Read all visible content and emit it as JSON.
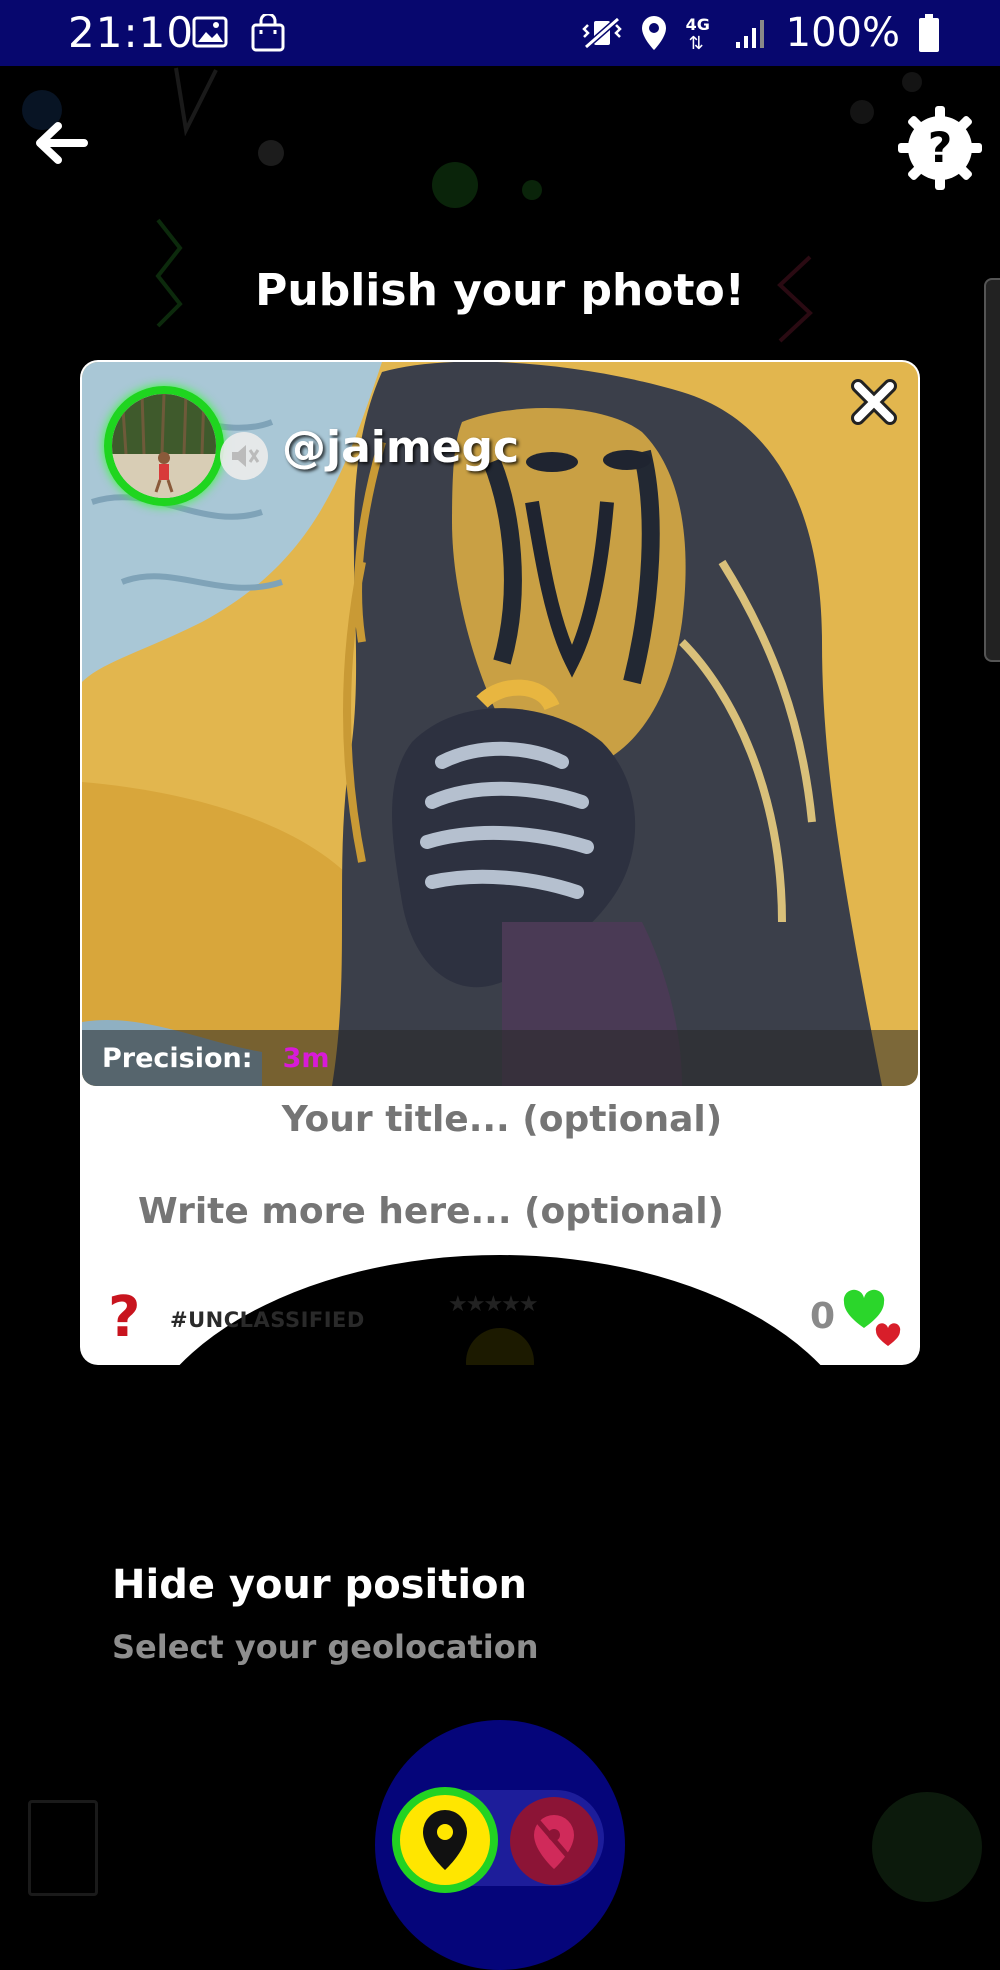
{
  "status_bar": {
    "time": "21:10",
    "icons_left": [
      "gallery-icon",
      "shopping-bag-icon"
    ],
    "icons_right": [
      "vibrate-mute-icon",
      "location-icon",
      "4g-data-icon",
      "signal-icon",
      "battery-icon"
    ],
    "network": "4G",
    "battery": "100%"
  },
  "header": {
    "back_icon": "arrow-left-icon",
    "help_icon": "help-gear-icon",
    "title": "Publish your photo!"
  },
  "card": {
    "username": "@jaimegc",
    "close_icon": "close-icon",
    "mute_icon": "mute-speaker-icon",
    "precision_label": "Precision:",
    "precision_value": "3m",
    "title_placeholder": "Your title... (optional)",
    "description_placeholder": "Write more here... (optional)",
    "category_icon": "question-mark-icon",
    "category": "#UNCLASSIFIED",
    "stars": "★★★★★",
    "likes": "0",
    "likes_icon": "hearts-icon"
  },
  "position": {
    "title": "Hide your position",
    "subtitle": "Select your geolocation",
    "show_icon": "location-pin-icon",
    "hide_icon": "location-off-icon"
  },
  "colors": {
    "status_bar": "#07076e",
    "avatar_ring": "#1fd51f",
    "precision_value": "#d81ad8",
    "selected_option": "#ffe600",
    "hide_option": "#8c1436"
  }
}
